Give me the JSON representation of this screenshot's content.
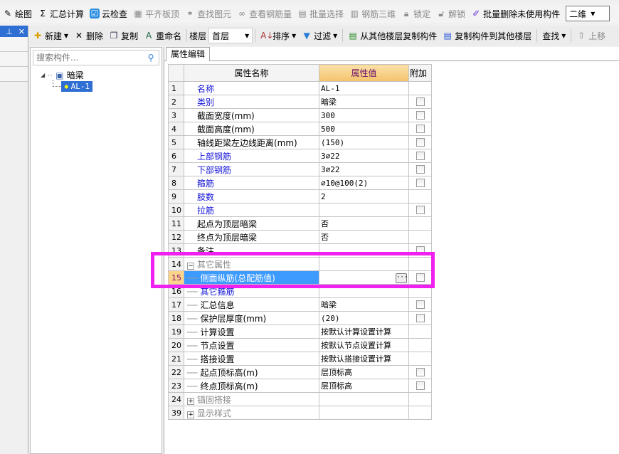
{
  "toolbar1": {
    "items": [
      {
        "label": "绘图",
        "icon": "draw-icon",
        "disabled": false
      },
      {
        "label": "汇总计算",
        "icon": "sigma-icon",
        "disabled": false
      },
      {
        "label": "云检查",
        "icon": "cloud-check-icon",
        "disabled": false
      },
      {
        "label": "平齐板顶",
        "icon": "align-top-icon",
        "disabled": true
      },
      {
        "label": "查找图元",
        "icon": "binoculars-icon",
        "disabled": true
      },
      {
        "label": "查看钢筋量",
        "icon": "rebar-view-icon",
        "disabled": true
      },
      {
        "label": "批量选择",
        "icon": "batch-select-icon",
        "disabled": true
      },
      {
        "label": "钢筋三维",
        "icon": "rebar-3d-icon",
        "disabled": true
      },
      {
        "label": "锁定",
        "icon": "lock-icon",
        "disabled": true
      },
      {
        "label": "解锁",
        "icon": "unlock-icon",
        "disabled": true
      },
      {
        "label": "批量删除未使用构件",
        "icon": "brush-icon",
        "disabled": false
      }
    ],
    "view_combo": "二维"
  },
  "toolbar2": {
    "new": "新建",
    "delete": "删除",
    "copy": "复制",
    "rename": "重命名",
    "floor_label": "楼层",
    "floor_value": "首层",
    "sort": "排序",
    "filter": "过滤",
    "copy_from": "从其他楼层复制构件",
    "copy_to": "复制构件到其他楼层",
    "find": "查找",
    "move_up": "上移"
  },
  "tree": {
    "search_placeholder": "搜索构件...",
    "root": "暗梁",
    "child": "AL-1"
  },
  "props": {
    "tab": "属性编辑",
    "headers": [
      "属性名称",
      "属性值",
      "附加"
    ],
    "rows": [
      {
        "n": "1",
        "name": "名称",
        "value": "AL-1",
        "blue": true,
        "cb": false
      },
      {
        "n": "2",
        "name": "类别",
        "value": "暗梁",
        "blue": true,
        "cb": true
      },
      {
        "n": "3",
        "name": "截面宽度(mm)",
        "value": "300",
        "cb": true
      },
      {
        "n": "4",
        "name": "截面高度(mm)",
        "value": "500",
        "cb": true
      },
      {
        "n": "5",
        "name": "轴线距梁左边线距离(mm)",
        "value": "(150)",
        "cb": true
      },
      {
        "n": "6",
        "name": "上部钢筋",
        "value": "3⌀22",
        "blue": true,
        "cb": true
      },
      {
        "n": "7",
        "name": "下部钢筋",
        "value": "3⌀22",
        "blue": true,
        "cb": true
      },
      {
        "n": "8",
        "name": "箍筋",
        "value": "⌀10@100(2)",
        "blue": true,
        "cb": true
      },
      {
        "n": "9",
        "name": "肢数",
        "value": "2",
        "blue": true,
        "cb": false
      },
      {
        "n": "10",
        "name": "拉筋",
        "value": "",
        "blue": true,
        "cb": true
      },
      {
        "n": "11",
        "name": "起点为顶层暗梁",
        "value": "否",
        "cb": false
      },
      {
        "n": "12",
        "name": "终点为顶层暗梁",
        "value": "否",
        "cb": false
      },
      {
        "n": "13",
        "name": "备注",
        "value": "",
        "cb": true
      },
      {
        "n": "14",
        "name": "其它属性",
        "value": "",
        "group": "minus",
        "cb": false
      },
      {
        "n": "15",
        "name": "侧面纵筋(总配筋值)",
        "value": "",
        "child": true,
        "selected": true,
        "cb": true
      },
      {
        "n": "16",
        "name": "其它箍筋",
        "value": "",
        "child": true,
        "blue": true,
        "cb": false
      },
      {
        "n": "17",
        "name": "汇总信息",
        "value": "暗梁",
        "child": true,
        "cb": true
      },
      {
        "n": "18",
        "name": "保护层厚度(mm)",
        "value": "(20)",
        "child": true,
        "cb": true
      },
      {
        "n": "19",
        "name": "计算设置",
        "value": "按默认计算设置计算",
        "child": true,
        "cb": false
      },
      {
        "n": "20",
        "name": "节点设置",
        "value": "按默认节点设置计算",
        "child": true,
        "cb": false
      },
      {
        "n": "21",
        "name": "搭接设置",
        "value": "按默认搭接设置计算",
        "child": true,
        "cb": false
      },
      {
        "n": "22",
        "name": "起点顶标高(m)",
        "value": "层顶标高",
        "child": true,
        "cb": true
      },
      {
        "n": "23",
        "name": "终点顶标高(m)",
        "value": "层顶标高",
        "child": true,
        "cb": true
      },
      {
        "n": "24",
        "name": "锚固搭接",
        "value": "",
        "group": "plus",
        "cb": false
      },
      {
        "n": "39",
        "name": "显示样式",
        "value": "",
        "group": "plus",
        "cb": false
      }
    ]
  },
  "colors": {
    "highlight": "#f020f0",
    "selection": "#3d9bff",
    "link": "#1414d8"
  }
}
